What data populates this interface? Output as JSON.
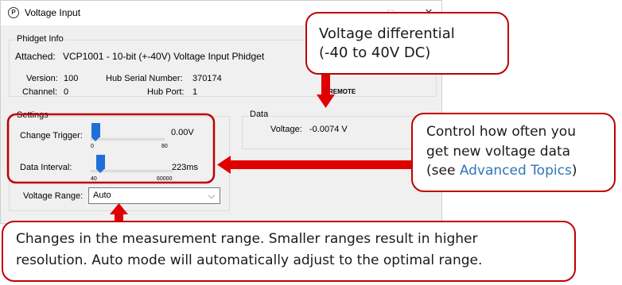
{
  "window": {
    "title": "Voltage Input",
    "app_icon_glyph": "P",
    "minimize_glyph": "–",
    "maximize_glyph": "□",
    "close_glyph": "✕"
  },
  "phidget_info": {
    "group_label": "Phidget Info",
    "attached_label": "Attached:",
    "attached_value": "VCP1001 - 10-bit (+-40V) Voltage Input Phidget",
    "version_label": "Version:",
    "version_value": "100",
    "channel_label": "Channel:",
    "channel_value": "0",
    "hub_serial_label": "Hub Serial Number:",
    "hub_serial_value": "370174",
    "hub_port_label": "Hub Port:",
    "hub_port_value": "1",
    "remote_fragment": "REMOTE"
  },
  "settings": {
    "group_label": "Settings",
    "change_trigger": {
      "label": "Change Trigger:",
      "value": "0.00V",
      "min": "0",
      "max": "80",
      "level": 0.0
    },
    "data_interval": {
      "label": "Data Interval:",
      "value": "223ms",
      "min": "40",
      "max": "60000",
      "level": 0.003
    },
    "voltage_range": {
      "label": "Voltage Range:",
      "selected": "Auto"
    }
  },
  "data_group": {
    "group_label": "Data",
    "voltage_label": "Voltage:",
    "voltage_value": "-0.0074 V"
  },
  "callouts": {
    "top_line1": "Voltage differential",
    "top_line2": "(-40 to 40V DC)",
    "right_line1": "Control how often you",
    "right_line2": "get new voltage data",
    "right_line3_pre": "(see ",
    "right_line3_link": "Advanced Topics",
    "right_line3_post": ")",
    "bottom_line1": "Changes in the measurement range. Smaller ranges result in higher",
    "bottom_line2": "resolution. Auto mode will automatically adjust to the optimal range."
  },
  "colors": {
    "callout_border": "#c00000",
    "slider_thumb": "#1e6fd9",
    "link": "#2e75b6"
  }
}
